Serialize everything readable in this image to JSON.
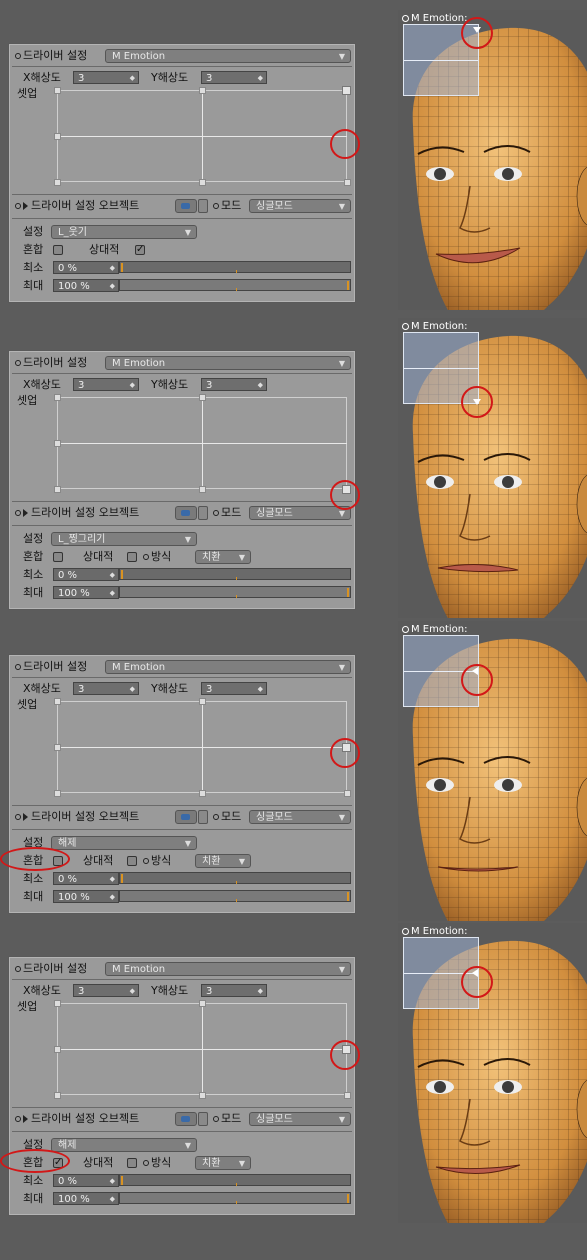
{
  "labels": {
    "driver_setting": "드라이버 설정",
    "driver_value": "M Emotion",
    "x_res": "X해상도",
    "y_res": "Y해상도",
    "x_res_val": "3",
    "y_res_val": "3",
    "setup": "셋업",
    "driver_object": "드라이버 설정 오브젝트",
    "mode": "모드",
    "mode_val": "싱글모드",
    "setting": "설정",
    "mix": "혼합",
    "relative": "상대적",
    "method": "방식",
    "method_val": "치환",
    "min": "최소",
    "max": "최대",
    "min_val": "0 %",
    "max_val": "100 %",
    "view_label": "M  Emotion:"
  },
  "steps": [
    {
      "setting_val": "L_웃기",
      "mix_checked": false,
      "relative_checked": true,
      "show_method": false,
      "mix_highlight": false
    },
    {
      "setting_val": "L_찡그리기",
      "mix_checked": false,
      "relative_checked": false,
      "show_method": true,
      "mix_highlight": false
    },
    {
      "setting_val": "해제",
      "mix_checked": false,
      "relative_checked": false,
      "show_method": true,
      "mix_highlight": true
    },
    {
      "setting_val": "해제",
      "mix_checked": true,
      "relative_checked": false,
      "show_method": true,
      "mix_highlight": true
    }
  ],
  "colors": {
    "highlight_ring": "#d21818",
    "skin": "#d89a4a",
    "wire": "#3a2410"
  },
  "icons": [
    "chevron-down-icon",
    "spin-icon",
    "link-icon",
    "radio-dot-icon",
    "check-icon"
  ]
}
